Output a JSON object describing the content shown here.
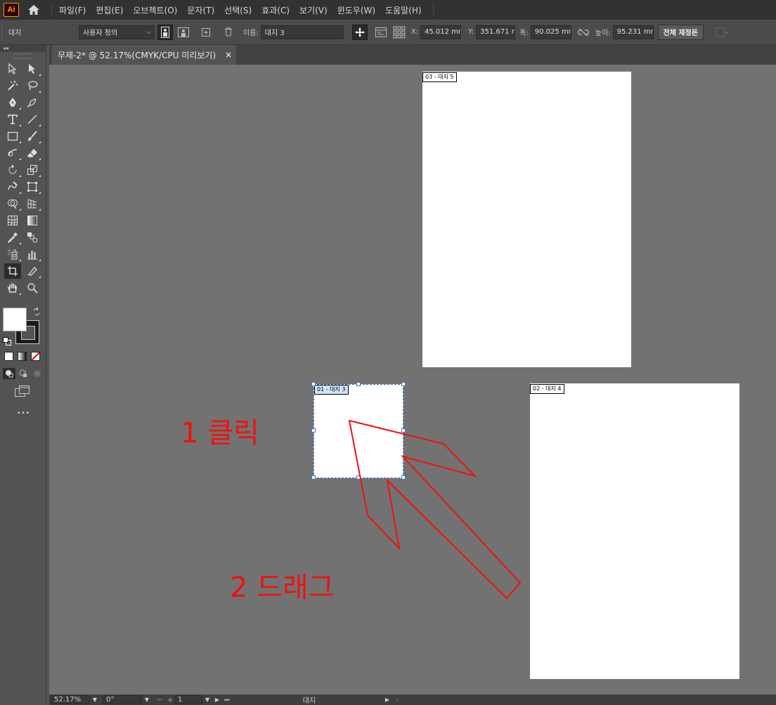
{
  "app": {
    "logo_text": "Ai",
    "menu": [
      "파일(F)",
      "편집(E)",
      "오브젝트(O)",
      "문자(T)",
      "선택(S)",
      "효과(C)",
      "보기(V)",
      "윈도우(W)",
      "도움말(H)"
    ]
  },
  "control": {
    "mode_label": "대지",
    "preset_value": "사용자 정의",
    "name_tag": "이름:",
    "name_value": "대지 3",
    "x_tag": "X:",
    "x_value": "45.012 mm",
    "y_tag": "Y:",
    "y_value": "351.671 m",
    "w_tag": "폭:",
    "w_value": "90.025 mm",
    "h_tag": "높이:",
    "h_value": "95.231 mm",
    "rearrange_label": "전체 재정돈"
  },
  "document": {
    "tab_title": "무제-2* @ 52.17%(CMYK/CPU 미리보기)",
    "close_glyph": "×"
  },
  "artboards": [
    {
      "label": "03 - 대지 5"
    },
    {
      "label": "01 - 대지 3"
    },
    {
      "label": "02 - 대지 4"
    }
  ],
  "annotations": {
    "step1": "1 클릭",
    "step2": "2 드래그",
    "arrow_color": "#ee1111"
  },
  "status": {
    "zoom": "52.17%",
    "rotation": "0°",
    "page": "1",
    "tool_name": "대지"
  },
  "toolbar": {
    "more_glyph": "•••",
    "tb_head": "◂◂"
  }
}
